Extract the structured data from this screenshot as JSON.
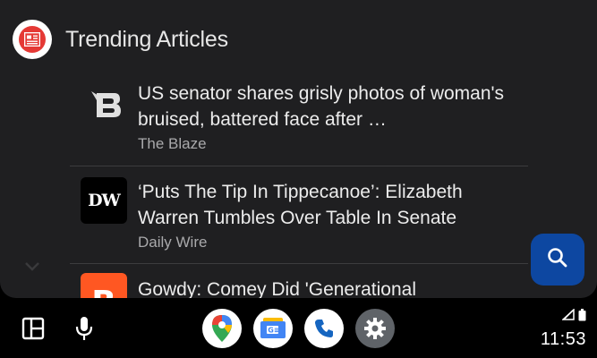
{
  "header": {
    "title": "Trending Articles",
    "app_icon": "newspaper-icon"
  },
  "articles": [
    {
      "headline": "US senator shares grisly photos of woman's bruised, battered face after …",
      "source": "The Blaze",
      "logo_text": "B",
      "logo_color": "#1f1f21"
    },
    {
      "headline": "‘Puts The Tip In Tippecanoe’: Elizabeth Warren Tumbles Over Table In Senate",
      "source": "Daily Wire",
      "logo_text": "DW",
      "logo_color": "#000000"
    },
    {
      "headline": "Gowdy: Comey Did 'Generational",
      "source": "",
      "logo_text": "B",
      "logo_color": "#ff5722"
    }
  ],
  "fab": {
    "icon": "search-icon",
    "color": "#0d47a1"
  },
  "navbar": {
    "left_icons": [
      "dashboard-icon",
      "microphone-icon"
    ],
    "apps": [
      "google-maps-icon",
      "google-news-icon",
      "phone-icon",
      "settings-icon"
    ],
    "clock": "11:53",
    "status_icons": [
      "signal-icon",
      "battery-icon"
    ]
  }
}
